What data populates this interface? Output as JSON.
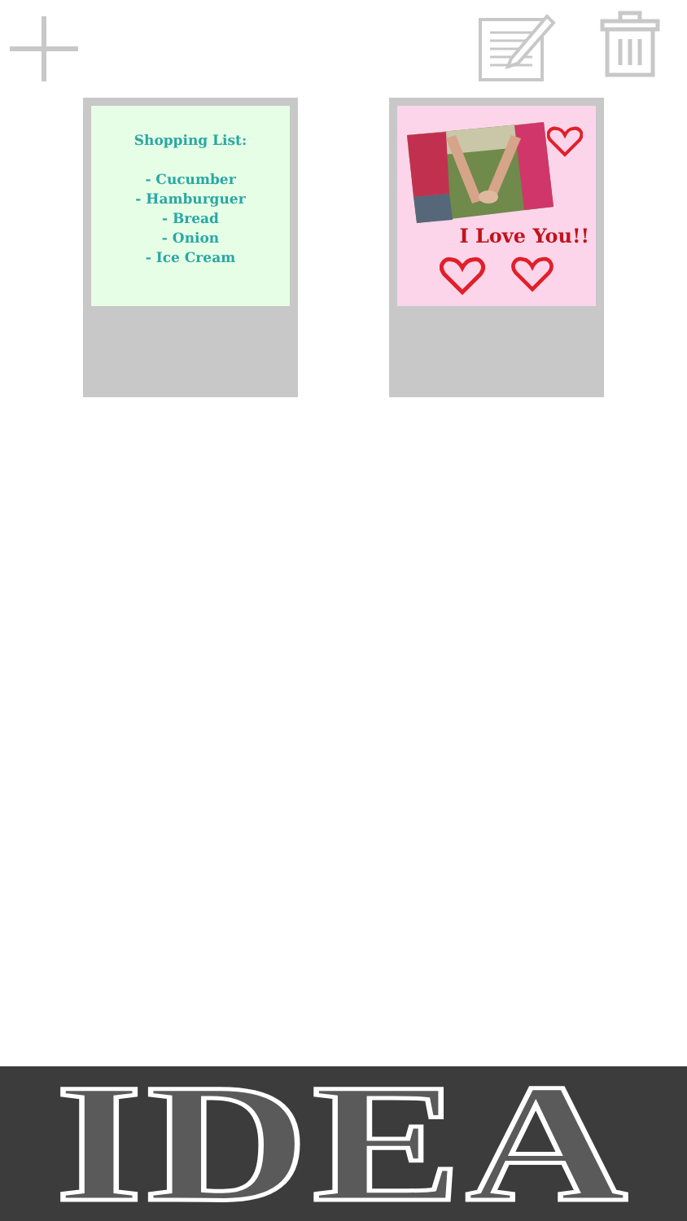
{
  "toolbar": {
    "buttons": [
      {
        "kind": "add"
      },
      {
        "kind": "edit"
      },
      {
        "kind": "delete"
      }
    ]
  },
  "notes": [
    {
      "kind": "text",
      "title": "Shopping List:",
      "lines": [
        "- Cucumber",
        "- Hamburguer",
        "- Bread",
        "- Onion",
        "- Ice Cream"
      ]
    },
    {
      "caption": "I Love You!!"
    }
  ],
  "banner": {
    "title": "IDEA"
  }
}
